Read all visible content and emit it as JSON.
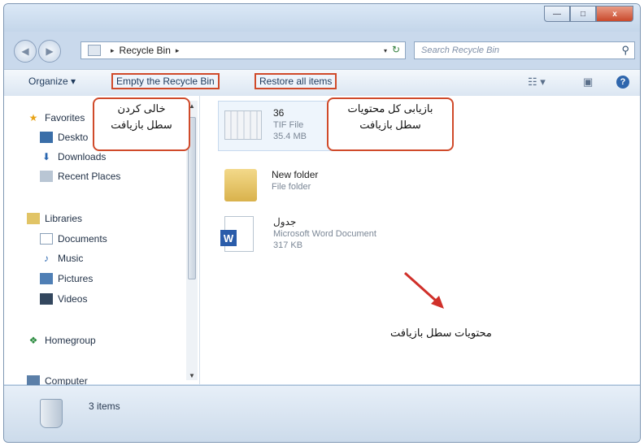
{
  "window": {
    "controls": {
      "minimize": "—",
      "maximize": "□",
      "close": "x"
    }
  },
  "address_bar": {
    "back": "◀",
    "forward": "▶",
    "crumb_sep": "▸",
    "path": "Recycle Bin",
    "path_tail": "▸",
    "dropdown": "▾",
    "refresh": "↻"
  },
  "search": {
    "placeholder": "Search Recycle Bin",
    "icon": "search-icon"
  },
  "toolbar": {
    "organize": "Organize ▾",
    "empty": "Empty the Recycle Bin",
    "restore": "Restore all items",
    "views": "☷ ▾",
    "preview": "▣",
    "help": "?"
  },
  "nav": {
    "favorites": "Favorites",
    "desktop": "Deskto",
    "downloads": "Downloads",
    "recent": "Recent Places",
    "libraries": "Libraries",
    "documents": "Documents",
    "music": "Music",
    "pictures": "Pictures",
    "videos": "Videos",
    "homegroup": "Homegroup",
    "computer": "Computer"
  },
  "files": [
    {
      "name": "36",
      "type": "TIF File",
      "size": "35.4 MB",
      "icon": "image-thumbnail-icon"
    },
    {
      "name": "New folder",
      "type": "File folder",
      "icon": "folder-icon"
    },
    {
      "name": "جدول",
      "type": "Microsoft Word Document",
      "size": "317 KB",
      "icon": "word-document-icon"
    }
  ],
  "status": {
    "count": "3 items",
    "icon": "recycle-bin-icon"
  },
  "annotations": {
    "empty_callout": [
      "خالی کردن",
      "سطل بازیافت"
    ],
    "restore_callout": [
      "بازیابی کل محتویات",
      "سطل بازیافت"
    ],
    "content_label": "محتویات سطل بازیافت"
  },
  "colors": {
    "accent_red": "#d04a2a",
    "window_blue": "#c9d9ec"
  }
}
